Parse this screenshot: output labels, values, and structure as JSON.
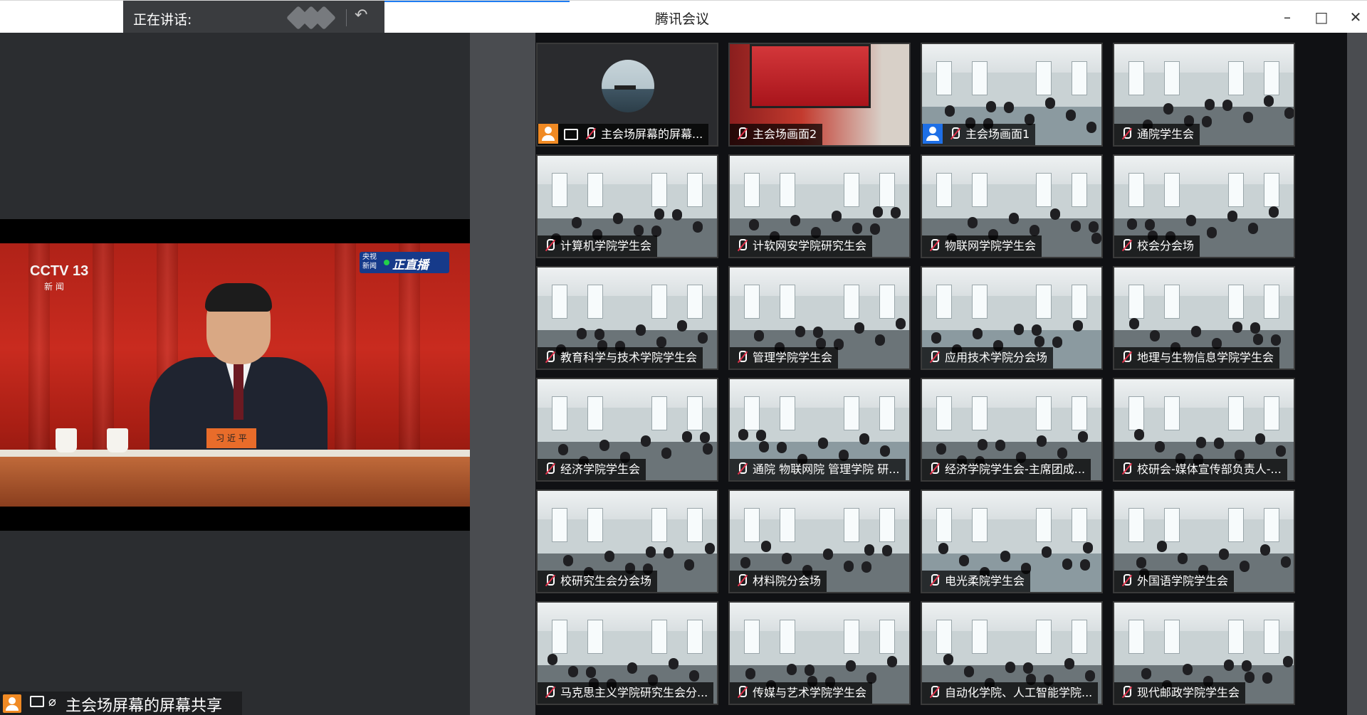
{
  "window": {
    "title": "腾讯会议",
    "speaking_label": "正在讲话:",
    "controls": [
      "minimize-icon",
      "maximize-icon",
      "close-icon"
    ]
  },
  "main_share": {
    "label": "主会场屏幕的屏幕共享",
    "broadcast": {
      "channel_logo": "CCTV 13",
      "channel_sub": "新 闻",
      "source": "央视新闻",
      "live_text": "正直播",
      "nameplate": "习 近 平"
    }
  },
  "tiles": [
    {
      "name": "主会场屏幕的屏幕...",
      "person_icon": "orange",
      "share_icon": true,
      "scene": "avatar"
    },
    {
      "name": "主会场画面2",
      "scene": "red-screen"
    },
    {
      "name": "主会场画面1",
      "person_icon": "blue",
      "scene": "hall"
    },
    {
      "name": "通院学生会",
      "scene": "room"
    },
    {
      "name": "计算机学院学生会",
      "scene": "room"
    },
    {
      "name": "计软网安学院研究生会",
      "scene": "room"
    },
    {
      "name": "物联网学院学生会",
      "scene": "room"
    },
    {
      "name": "校会分会场",
      "scene": "room"
    },
    {
      "name": "教育科学与技术学院学生会",
      "scene": "room"
    },
    {
      "name": "管理学院学生会",
      "scene": "room"
    },
    {
      "name": "应用技术学院分会场",
      "scene": "hall"
    },
    {
      "name": "地理与生物信息学院学生会",
      "scene": "room"
    },
    {
      "name": "经济学院学生会",
      "scene": "room"
    },
    {
      "name": "通院 物联网院 管理学院 研...",
      "scene": "hall"
    },
    {
      "name": "经济学院学生会-主席团成...",
      "scene": "room"
    },
    {
      "name": "校研会-媒体宣传部负责人-...",
      "scene": "room"
    },
    {
      "name": "校研究生会分会场",
      "scene": "room"
    },
    {
      "name": "材料院分会场",
      "scene": "room"
    },
    {
      "name": "电光柔院学生会",
      "scene": "hall"
    },
    {
      "name": "外国语学院学生会",
      "scene": "room"
    },
    {
      "name": "马克思主义学院研究生会分...",
      "scene": "room"
    },
    {
      "name": "传媒与艺术学院学生会",
      "scene": "room"
    },
    {
      "name": "自动化学院、人工智能学院...",
      "scene": "room"
    },
    {
      "name": "现代邮政学院学生会",
      "scene": "room"
    }
  ],
  "colors": {
    "accent": "#1e7cf2",
    "mic_muted": "#e0324b",
    "person_orange": "#f08a24",
    "person_blue": "#1e6fe6"
  }
}
